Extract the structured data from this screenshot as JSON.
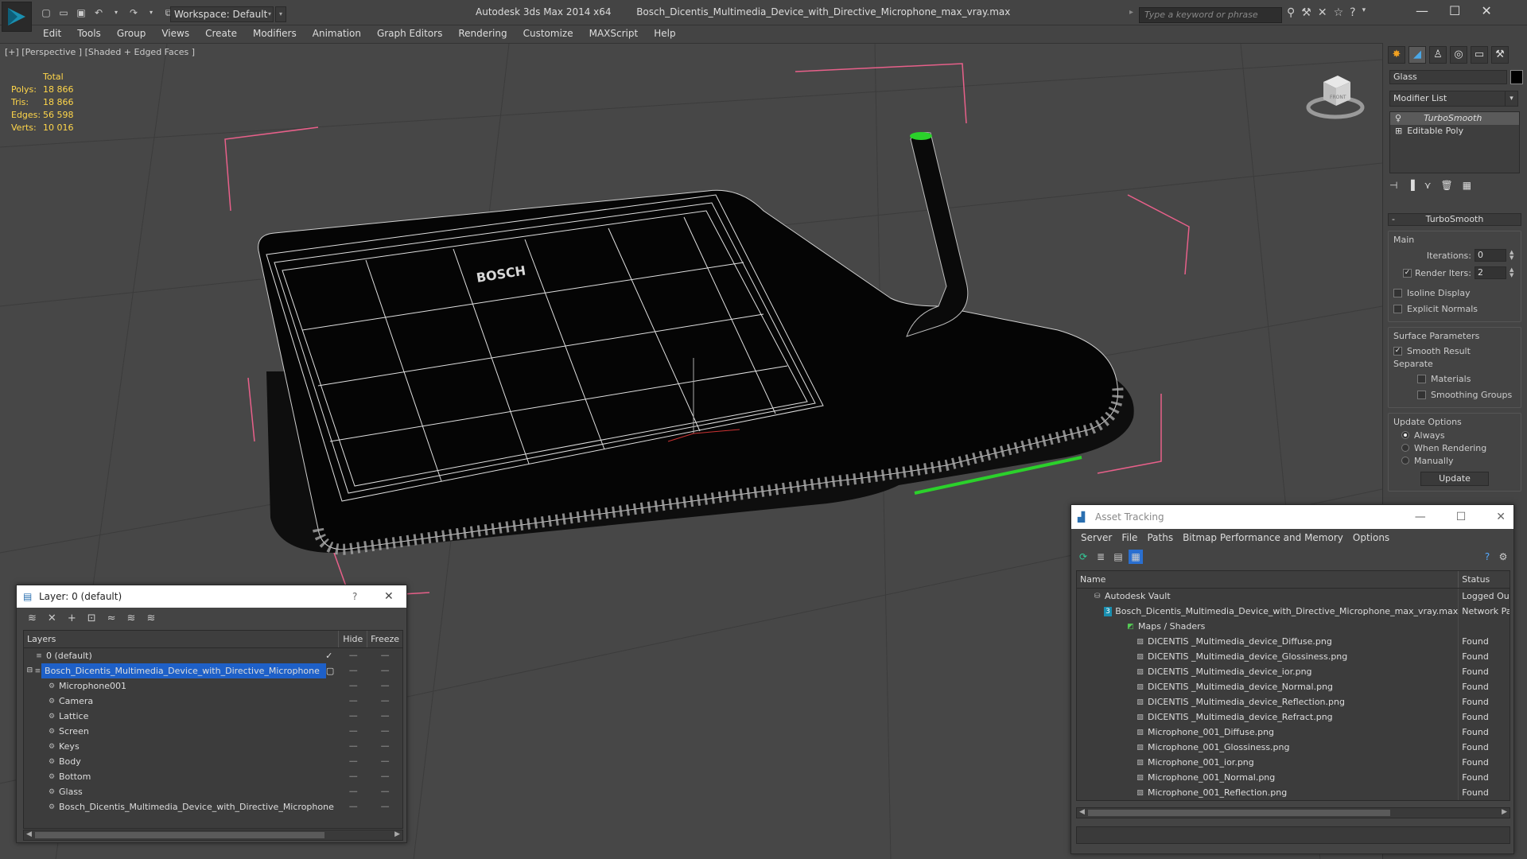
{
  "app": {
    "title": "Autodesk 3ds Max  2014 x64",
    "file": "Bosch_Dicentis_Multimedia_Device_with_Directive_Microphone_max_vray.max",
    "workspace": "Workspace: Default",
    "search_placeholder": "Type a keyword or phrase"
  },
  "menu": [
    "Edit",
    "Tools",
    "Group",
    "Views",
    "Create",
    "Modifiers",
    "Animation",
    "Graph Editors",
    "Rendering",
    "Customize",
    "MAXScript",
    "Help"
  ],
  "viewport": {
    "label": "[+] [Perspective ] [Shaded + Edged Faces ]",
    "stats_header": "Total",
    "stats": [
      {
        "k": "Polys:",
        "v": "18 866"
      },
      {
        "k": "Tris:",
        "v": "18 866"
      },
      {
        "k": "Edges:",
        "v": "56 598"
      },
      {
        "k": "Verts:",
        "v": "10 016"
      }
    ],
    "brand_text": "BOSCH",
    "viewcube_label": "FRONT"
  },
  "command_panel": {
    "object_name": "Glass",
    "modifier_list": "Modifier List",
    "stack": [
      "TurboSmooth",
      "Editable Poly"
    ],
    "rollout_title": "TurboSmooth",
    "main_label": "Main",
    "iterations_label": "Iterations:",
    "iterations_value": "0",
    "render_iters_label": "Render Iters:",
    "render_iters_value": "2",
    "isoline": "Isoline Display",
    "explicit_normals": "Explicit Normals",
    "surface_params": "Surface Parameters",
    "smooth_result": "Smooth Result",
    "separate": "Separate",
    "materials": "Materials",
    "smoothing_groups": "Smoothing Groups",
    "update_options": "Update Options",
    "always": "Always",
    "when_rendering": "When Rendering",
    "manually": "Manually",
    "update_button": "Update"
  },
  "layer_dialog": {
    "title": "Layer: 0 (default)",
    "help": "?",
    "col_layers": "Layers",
    "col_hide": "Hide",
    "col_freeze": "Freeze",
    "rows": [
      {
        "name": "0 (default)",
        "indent": 1
      },
      {
        "name": "Bosch_Dicentis_Multimedia_Device_with_Directive_Microphone",
        "indent": 1
      },
      {
        "name": "Microphone001",
        "indent": 2
      },
      {
        "name": "Camera",
        "indent": 2
      },
      {
        "name": "Lattice",
        "indent": 2
      },
      {
        "name": "Screen",
        "indent": 2
      },
      {
        "name": "Keys",
        "indent": 2
      },
      {
        "name": "Body",
        "indent": 2
      },
      {
        "name": "Bottom",
        "indent": 2
      },
      {
        "name": "Glass",
        "indent": 2
      },
      {
        "name": "Bosch_Dicentis_Multimedia_Device_with_Directive_Microphone",
        "indent": 2
      }
    ]
  },
  "asset_dialog": {
    "title": "Asset Tracking",
    "menu": [
      "Server",
      "File",
      "Paths",
      "Bitmap Performance and Memory",
      "Options"
    ],
    "col_name": "Name",
    "col_status": "Status",
    "rows": [
      {
        "name": "Autodesk Vault",
        "status": "Logged Out",
        "indent": 1
      },
      {
        "name": "Bosch_Dicentis_Multimedia_Device_with_Directive_Microphone_max_vray.max",
        "status": "Network Pa",
        "indent": 2
      },
      {
        "name": "Maps / Shaders",
        "status": "",
        "indent": 3
      },
      {
        "name": "DICENTIS _Multimedia_device_Diffuse.png",
        "status": "Found",
        "indent": 4
      },
      {
        "name": "DICENTIS _Multimedia_device_Glossiness.png",
        "status": "Found",
        "indent": 4
      },
      {
        "name": "DICENTIS _Multimedia_device_ior.png",
        "status": "Found",
        "indent": 4
      },
      {
        "name": "DICENTIS _Multimedia_device_Normal.png",
        "status": "Found",
        "indent": 4
      },
      {
        "name": "DICENTIS _Multimedia_device_Reflection.png",
        "status": "Found",
        "indent": 4
      },
      {
        "name": "DICENTIS _Multimedia_device_Refract.png",
        "status": "Found",
        "indent": 4
      },
      {
        "name": "Microphone_001_Diffuse.png",
        "status": "Found",
        "indent": 4
      },
      {
        "name": "Microphone_001_Glossiness.png",
        "status": "Found",
        "indent": 4
      },
      {
        "name": "Microphone_001_ior.png",
        "status": "Found",
        "indent": 4
      },
      {
        "name": "Microphone_001_Normal.png",
        "status": "Found",
        "indent": 4
      },
      {
        "name": "Microphone_001_Reflection.png",
        "status": "Found",
        "indent": 4
      }
    ]
  }
}
